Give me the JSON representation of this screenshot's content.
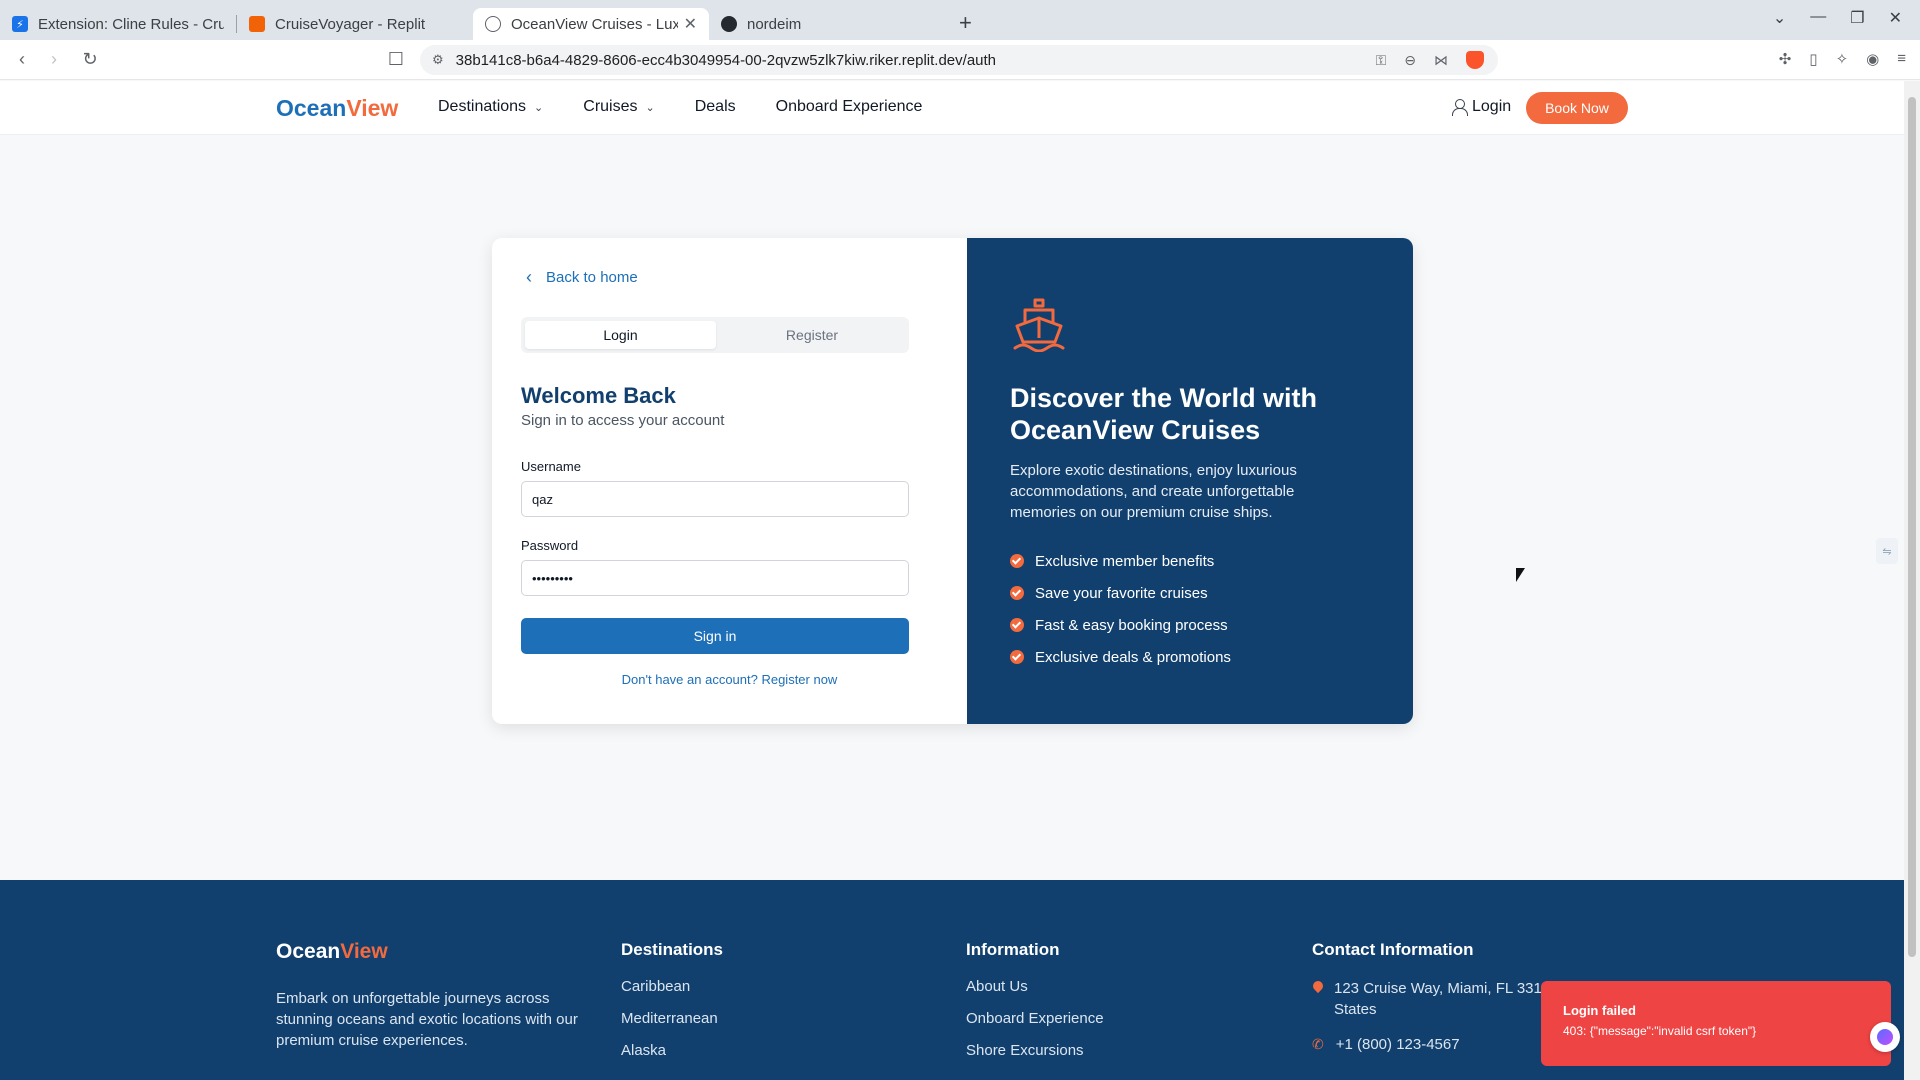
{
  "browser": {
    "tabs": [
      {
        "label": "Extension: Cline Rules - CruiseV",
        "icon": "cline-icon",
        "color": "#1a73e8"
      },
      {
        "label": "CruiseVoyager - Replit",
        "icon": "replit-icon",
        "color": "#f26207"
      },
      {
        "label": "OceanView Cruises - Luxury",
        "icon": "globe-icon",
        "color": "#5f6368",
        "active": true
      },
      {
        "label": "nordeim",
        "icon": "github-icon",
        "color": "#24292f"
      }
    ],
    "url": "38b141c8-b6a4-4829-8606-ecc4b3049954-00-2qvzw5zlk7kiw.riker.replit.dev/auth"
  },
  "header": {
    "logo_a": "Ocean",
    "logo_b": "View",
    "nav": [
      {
        "label": "Destinations",
        "dropdown": true
      },
      {
        "label": "Cruises",
        "dropdown": true
      },
      {
        "label": "Deals",
        "dropdown": false
      },
      {
        "label": "Onboard Experience",
        "dropdown": false
      }
    ],
    "login_label": "Login",
    "book_label": "Book Now"
  },
  "auth": {
    "back_label": "Back to home",
    "tab_login": "Login",
    "tab_register": "Register",
    "title": "Welcome Back",
    "subtitle": "Sign in to access your account",
    "username_label": "Username",
    "username_value": "qaz",
    "password_label": "Password",
    "password_value": "•••••••••",
    "signin_label": "Sign in",
    "register_prompt": "Don't have an account? Register now"
  },
  "hero": {
    "title": "Discover the World with OceanView Cruises",
    "text": "Explore exotic destinations, enjoy luxurious accommodations, and create unforgettable memories on our premium cruise ships.",
    "benefits": [
      "Exclusive member benefits",
      "Save your favorite cruises",
      "Fast & easy booking process",
      "Exclusive deals & promotions"
    ]
  },
  "footer": {
    "logo_a": "Ocean",
    "logo_b": "View",
    "description": "Embark on unforgettable journeys across stunning oceans and exotic locations with our premium cruise experiences.",
    "destinations_title": "Destinations",
    "destinations": [
      "Caribbean",
      "Mediterranean",
      "Alaska"
    ],
    "info_title": "Information",
    "info": [
      "About Us",
      "Onboard Experience",
      "Shore Excursions"
    ],
    "contact_title": "Contact Information",
    "address": "123 Cruise Way, Miami, FL 3310 States",
    "phone": "+1 (800) 123-4567"
  },
  "toast": {
    "title": "Login failed",
    "message": "403: {\"message\":\"invalid csrf token\"}"
  },
  "colors": {
    "primary": "#1d6fb8",
    "navy": "#12406e",
    "accent": "#f26a3d",
    "error": "#ef4444"
  }
}
